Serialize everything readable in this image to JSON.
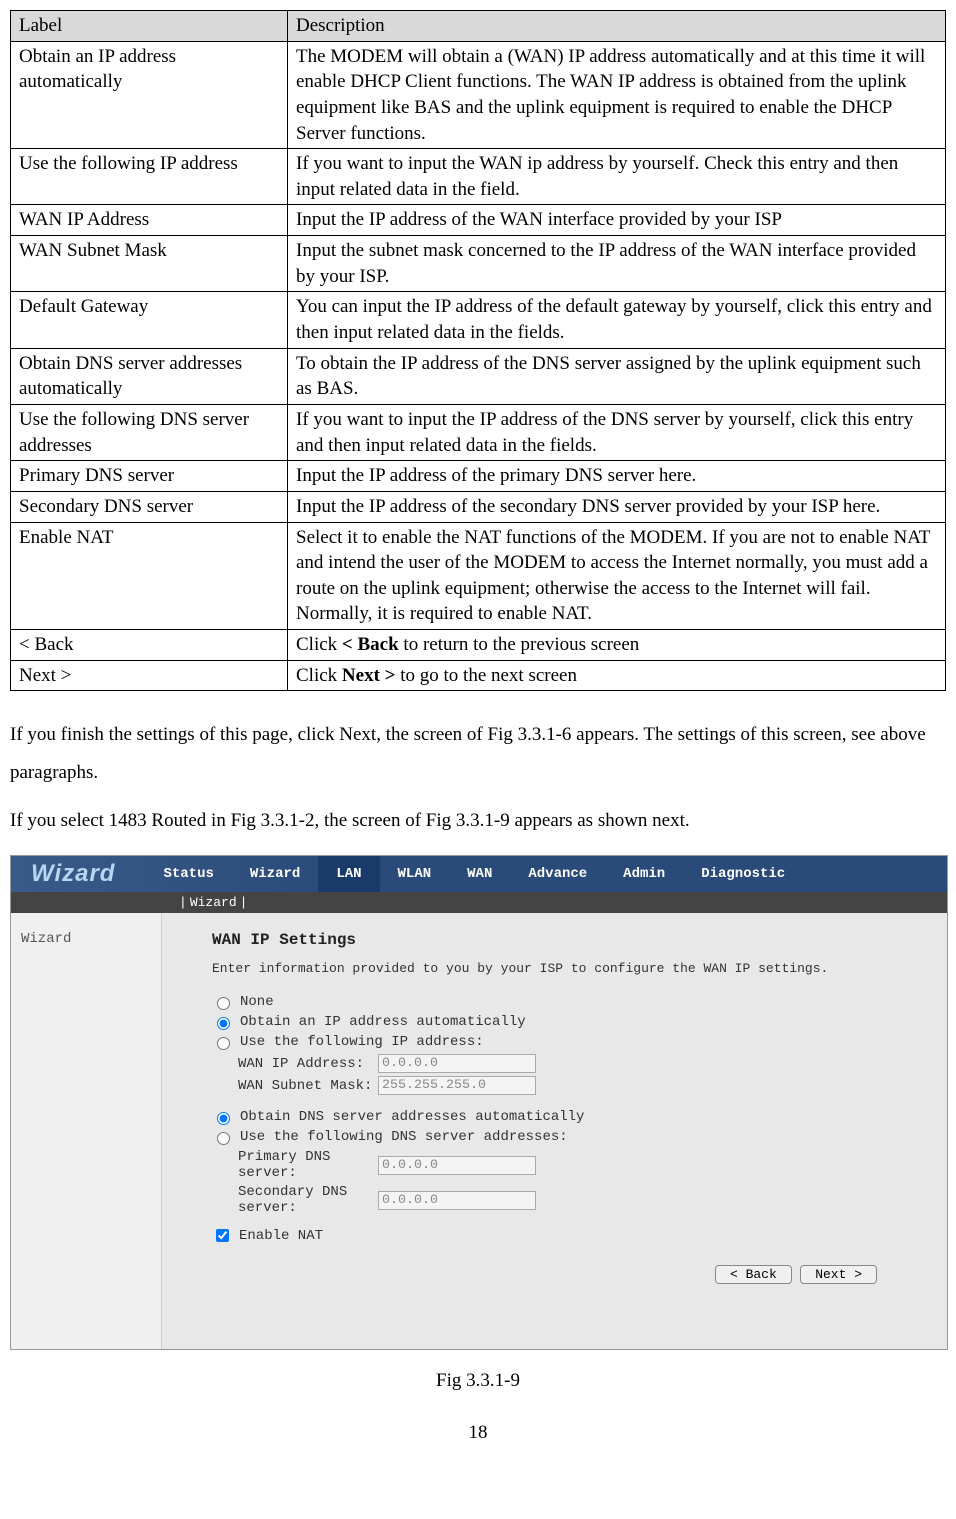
{
  "table": {
    "header": {
      "label": "Label",
      "desc": "Description"
    },
    "rows": [
      {
        "label": "Obtain an IP address automatically",
        "desc": "The MODEM will obtain a (WAN) IP address automatically and at this time it will enable DHCP Client functions. The WAN IP address is obtained from the uplink equipment like BAS and the uplink equipment is required to enable the DHCP Server functions."
      },
      {
        "label": "Use the following IP address",
        "desc": "If you want to input the WAN ip address by yourself. Check this entry and then input related data in the field."
      },
      {
        "label": "WAN IP Address",
        "desc": "Input the IP address of the WAN interface provided by your ISP"
      },
      {
        "label": "WAN Subnet Mask",
        "desc": "Input the subnet mask concerned to the IP address of the WAN interface provided by your ISP."
      },
      {
        "label": "Default Gateway",
        "desc": "You can input the IP address of the default gateway by yourself, click this entry and then input related data in the fields."
      },
      {
        "label": "Obtain DNS server addresses automatically",
        "desc": "To obtain the IP address of the DNS server assigned by the uplink equipment such as BAS."
      },
      {
        "label": "Use the following DNS server addresses",
        "desc": "If you want to input the IP address of the DNS server by yourself, click this entry and then input related data in the fields."
      },
      {
        "label": "Primary DNS server",
        "desc": "Input the IP address of the primary DNS server here."
      },
      {
        "label": "Secondary DNS server",
        "desc": "Input the IP address of the secondary DNS server provided by your ISP here."
      },
      {
        "label": "Enable NAT",
        "desc": "Select it to enable the NAT functions of the MODEM. If you are not to enable NAT and intend the user of the MODEM to access the Internet normally, you must add a route on the uplink equipment; otherwise the access to the Internet will fail. Normally, it is required to enable NAT."
      },
      {
        "label": "< Back",
        "desc_prefix": "Click ",
        "desc_bold": "< Back",
        "desc_suffix": " to return to the previous screen"
      },
      {
        "label": "Next >",
        "desc_prefix": "Click ",
        "desc_bold": "Next >",
        "desc_suffix": " to go to the next screen"
      }
    ]
  },
  "paragraph1": "If you finish the settings of this page, click Next, the screen of Fig 3.3.1-6 appears. The settings of this screen, see above paragraphs.",
  "paragraph2": "If you select 1483 Routed in Fig 3.3.1-2, the screen of Fig 3.3.1-9 appears as shown next.",
  "ui": {
    "wizard_brand": "Wizard",
    "nav": {
      "status": "Status",
      "wizard": "Wizard",
      "lan": "LAN",
      "wlan": "WLAN",
      "wan": "WAN",
      "advance": "Advance",
      "admin": "Admin",
      "diagnostic": "Diagnostic"
    },
    "subnav": "Wizard",
    "sidebar_label": "Wizard",
    "section_title": "WAN IP Settings",
    "section_sub": "Enter information provided to you by your ISP to configure the WAN IP settings.",
    "opt_none": "None",
    "opt_obtain_ip": "Obtain an IP address automatically",
    "opt_use_ip": "Use the following IP address:",
    "wan_ip_label": "WAN IP Address:",
    "wan_ip_value": "0.0.0.0",
    "wan_mask_label": "WAN Subnet Mask:",
    "wan_mask_value": "255.255.255.0",
    "opt_obtain_dns": "Obtain DNS server addresses automatically",
    "opt_use_dns": "Use the following DNS server addresses:",
    "primary_dns_label": "Primary DNS server:",
    "primary_dns_value": "0.0.0.0",
    "secondary_dns_label": "Secondary DNS server:",
    "secondary_dns_value": "0.0.0.0",
    "enable_nat": "Enable NAT",
    "back_btn": "< Back",
    "next_btn": "Next >"
  },
  "fig_caption": "Fig 3.3.1-9",
  "page_number": "18"
}
